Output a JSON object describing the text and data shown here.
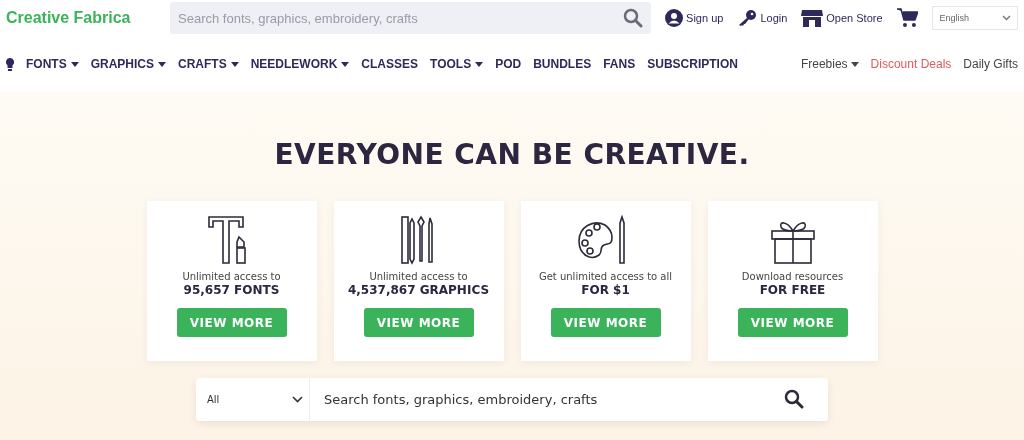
{
  "header": {
    "logo": "Creative Fabrica",
    "search": {
      "placeholder": "Search fonts, graphics, embroidery, crafts"
    },
    "links": [
      {
        "label": "Sign up",
        "kind": "user"
      },
      {
        "label": "Login",
        "kind": "key"
      },
      {
        "label": "Open Store",
        "kind": "store"
      }
    ],
    "language": "English"
  },
  "nav": {
    "items": [
      {
        "label": "FONTS",
        "dropdown": true
      },
      {
        "label": "GRAPHICS",
        "dropdown": true
      },
      {
        "label": "CRAFTS",
        "dropdown": true
      },
      {
        "label": "NEEDLEWORK",
        "dropdown": true
      },
      {
        "label": "CLASSES",
        "dropdown": false
      },
      {
        "label": "TOOLS",
        "dropdown": true
      },
      {
        "label": "POD",
        "dropdown": false
      },
      {
        "label": "BUNDLES",
        "dropdown": false
      },
      {
        "label": "FANS",
        "dropdown": false
      },
      {
        "label": "SUBSCRIPTION",
        "dropdown": false
      }
    ],
    "right_items": [
      {
        "label": "Freebies",
        "dropdown": true,
        "kind": "plain"
      },
      {
        "label": "Discount Deals",
        "dropdown": false,
        "kind": "deal"
      },
      {
        "label": "Daily Gifts",
        "dropdown": false,
        "kind": "plain"
      }
    ]
  },
  "hero": {
    "title": "EVERYONE CAN BE CREATIVE.",
    "cards": [
      {
        "kind": "fonts",
        "line": "Unlimited access to",
        "highlight": "95,657 FONTS",
        "button": "VIEW MORE"
      },
      {
        "kind": "graphics",
        "line": "Unlimited access to",
        "highlight": "4,537,867 GRAPHICS",
        "button": "VIEW MORE"
      },
      {
        "kind": "crafts",
        "line": "Get unlimited access to all",
        "highlight": "FOR $1",
        "button": "VIEW MORE"
      },
      {
        "kind": "free",
        "line": "Download resources",
        "highlight": "FOR FREE",
        "button": "VIEW MORE"
      }
    ],
    "search": {
      "category": "All",
      "placeholder": "Search fonts, graphics, embroidery, crafts"
    }
  }
}
